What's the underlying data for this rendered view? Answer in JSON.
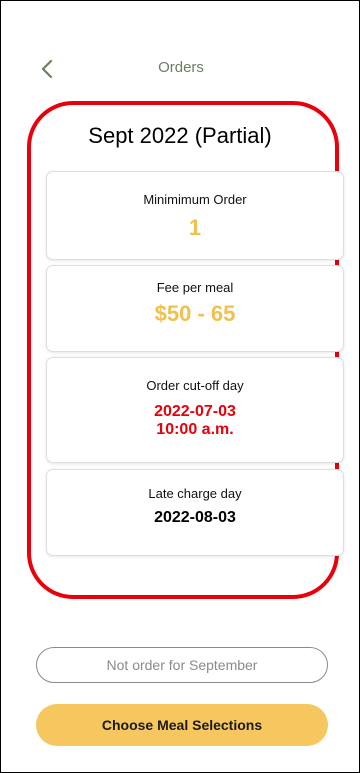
{
  "header": {
    "title": "Orders",
    "back_icon": "chevron-left-icon"
  },
  "section": {
    "title": "Sept 2022 (Partial)"
  },
  "cards": [
    {
      "label": "Minimimum Order",
      "value": "1"
    },
    {
      "label": "Fee per meal",
      "value": "$50 - 65"
    },
    {
      "label": "Order cut-off day",
      "value_line1": "2022-07-03",
      "value_line2": "10:00 a.m."
    },
    {
      "label": "Late charge day",
      "value": "2022-08-03"
    }
  ],
  "buttons": {
    "not_order": "Not order for September",
    "choose_meals": "Choose Meal Selections"
  },
  "colors": {
    "accent_yellow": "#f2c04e",
    "button_yellow": "#f5c75e",
    "highlight_red": "#e8000b",
    "title_green": "#6b7f5e",
    "deadline_red": "#e8000b"
  }
}
